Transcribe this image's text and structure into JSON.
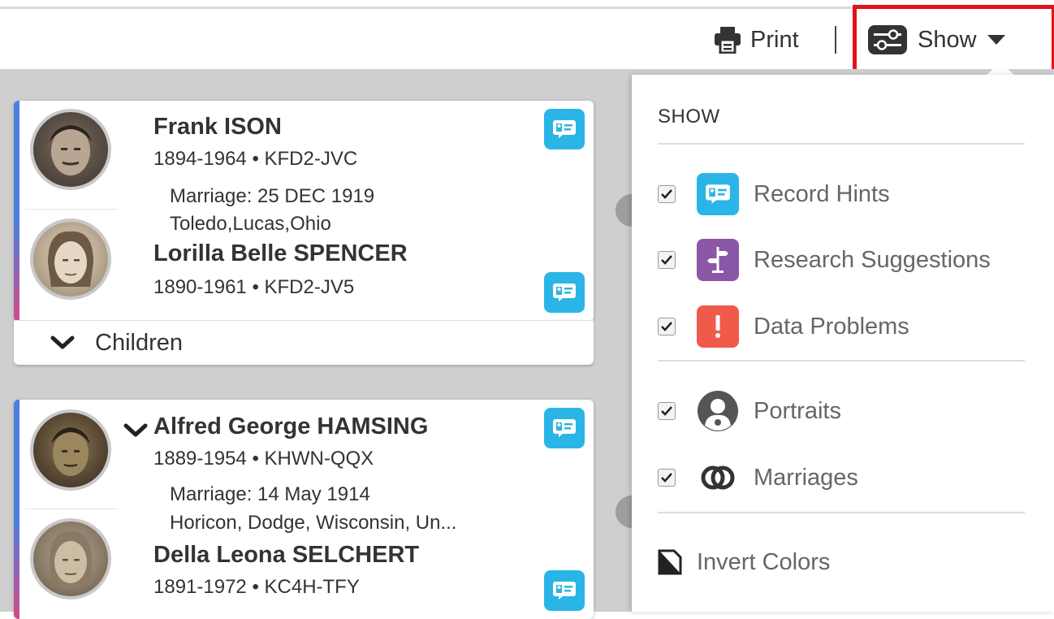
{
  "toolbar": {
    "print_label": "Print",
    "show_label": "Show"
  },
  "families": [
    {
      "husband": {
        "name": "Frank ISON",
        "dates_id": "1894-1964 • KFD2-JVC"
      },
      "marriage": {
        "date": "Marriage: 25 DEC 1919",
        "place": "Toledo,Lucas,Ohio"
      },
      "wife": {
        "name": "Lorilla Belle SPENCER",
        "dates_id": "1890-1961 • KFD2-JV5"
      },
      "children_label": "Children"
    },
    {
      "husband": {
        "name": "Alfred George HAMSING",
        "dates_id": "1889-1954 • KHWN-QQX"
      },
      "marriage": {
        "date": "Marriage: 14 May 1914",
        "place": "Horicon, Dodge, Wisconsin, Un..."
      },
      "wife": {
        "name": "Della Leona SELCHERT",
        "dates_id": "1891-1972 • KC4H-TFY"
      }
    }
  ],
  "show_panel": {
    "title": "SHOW",
    "options": [
      {
        "label": "Record Hints",
        "checked": true,
        "icon": "record-hint-icon",
        "color": "#2ab5e6"
      },
      {
        "label": "Research Suggestions",
        "checked": true,
        "icon": "signpost-icon",
        "color": "#8a56a6"
      },
      {
        "label": "Data Problems",
        "checked": true,
        "icon": "exclamation-icon",
        "color": "#ef5a4a"
      },
      {
        "label": "Portraits",
        "checked": true,
        "icon": "portrait-icon",
        "color": "#555555"
      },
      {
        "label": "Marriages",
        "checked": true,
        "icon": "rings-icon",
        "color": "#333333"
      }
    ],
    "invert_label": "Invert Colors"
  },
  "colors": {
    "highlight": "#e0131b",
    "male": "#4a7fe0",
    "female": "#d44a8a"
  }
}
